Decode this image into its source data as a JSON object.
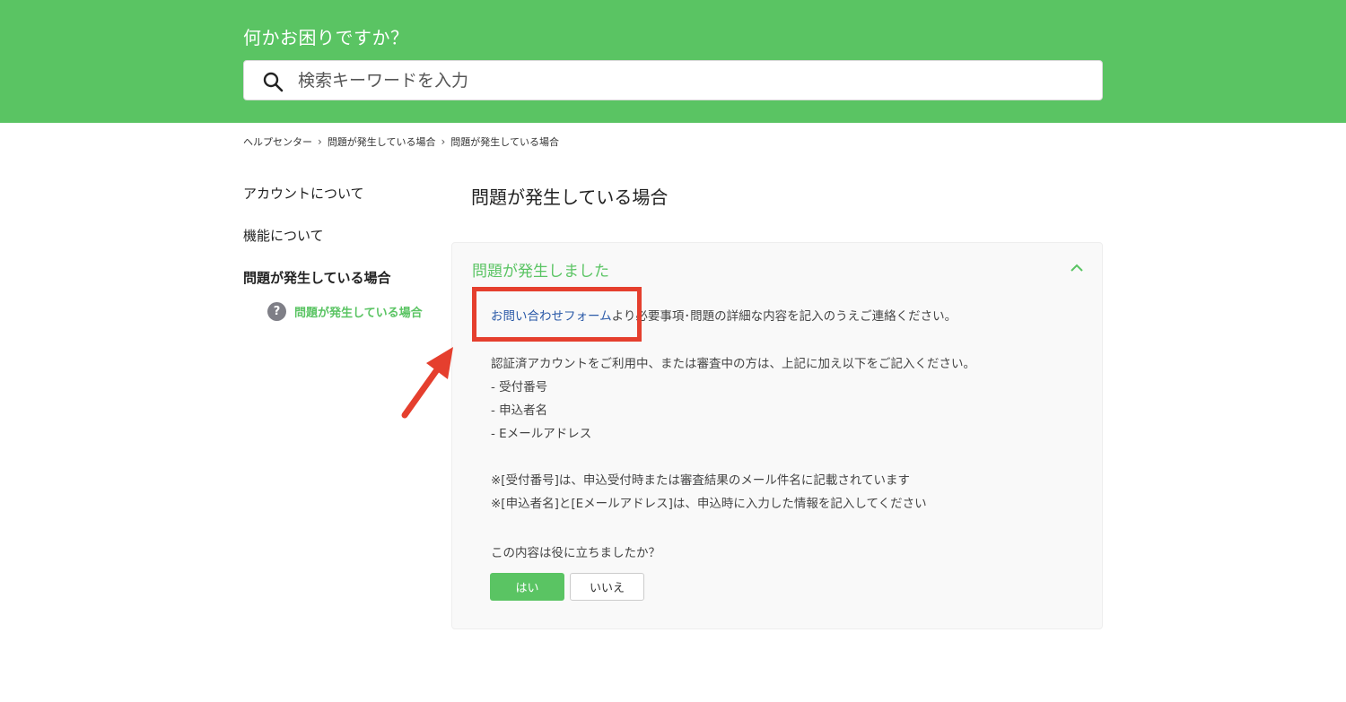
{
  "header": {
    "title": "何かお困りですか？",
    "search_placeholder": "検索キーワードを入力"
  },
  "breadcrumb": {
    "items": [
      "ヘルプセンター",
      "問題が発生している場合",
      "問題が発生している場合"
    ]
  },
  "sidebar": {
    "items": [
      {
        "label": "アカウントについて"
      },
      {
        "label": "機能について"
      },
      {
        "label": "問題が発生している場合"
      }
    ],
    "subitem": {
      "label": "問題が発生している場合",
      "icon": "question-circle-icon"
    }
  },
  "main": {
    "page_title": "問題が発生している場合",
    "article": {
      "title": "問題が発生しました",
      "link_text": "お問い合わせフォーム",
      "intro_rest": "より必要事項･問題の詳細な内容を記入のうえご連絡ください。",
      "verified_note": "認証済アカウントをご利用中、または審査中の方は、上記に加え以下をご記入ください。",
      "list": [
        "- 受付番号",
        "- 申込者名",
        "- Eメールアドレス"
      ],
      "notes": [
        "※[受付番号]は、申込受付時または審査結果のメール件名に記載されています",
        "※[申込者名]と[Eメールアドレス]は、申込時に入力した情報を記入してください"
      ],
      "feedback_question": "この内容は役に立ちましたか？",
      "yes_label": "はい",
      "no_label": "いいえ"
    }
  },
  "colors": {
    "brand_green": "#5ac463",
    "link_blue": "#2b5aa8",
    "annotation_red": "#e53f2e"
  }
}
